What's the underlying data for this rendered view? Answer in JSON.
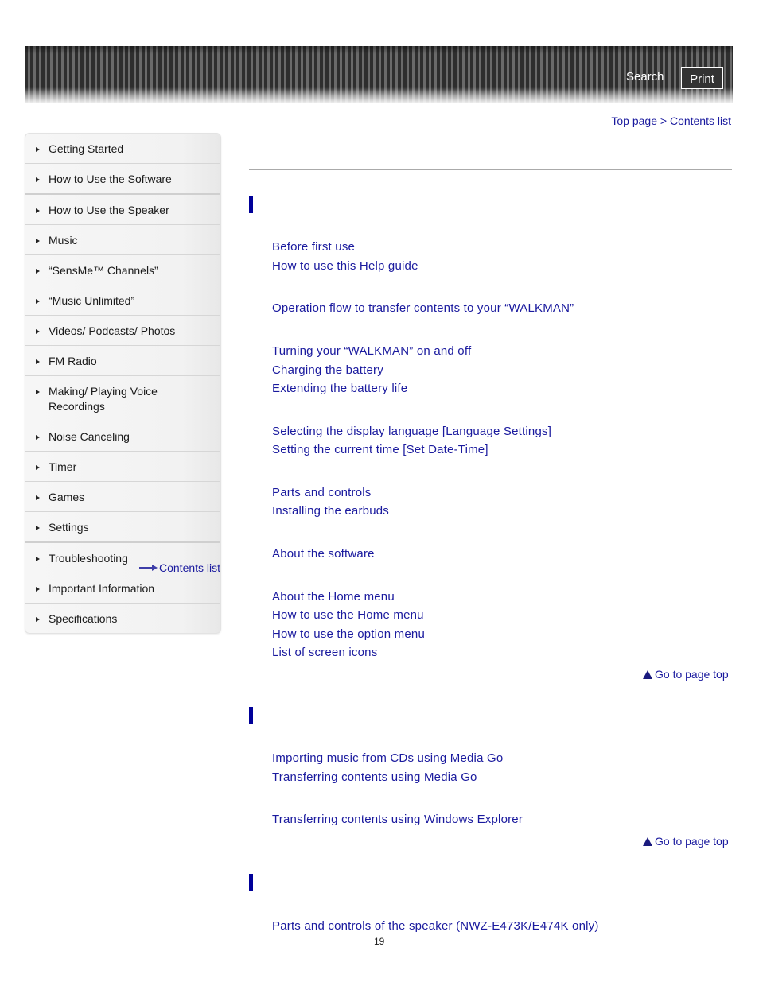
{
  "header": {
    "search_label": "Search",
    "print_label": "Print"
  },
  "breadcrumb": {
    "top_page": "Top page",
    "separator": ">",
    "contents_list": "Contents list"
  },
  "sidebar": {
    "items": [
      {
        "label": "Getting Started"
      },
      {
        "label": "How to Use the Software"
      },
      {
        "label": "How to Use the Speaker"
      },
      {
        "label": "Music"
      },
      {
        "label": "“SensMe™ Channels”"
      },
      {
        "label": "“Music Unlimited”"
      },
      {
        "label": "Videos/ Podcasts/ Photos"
      },
      {
        "label": "FM Radio"
      },
      {
        "label": "Making/ Playing Voice Recordings"
      },
      {
        "label": "Noise Canceling"
      },
      {
        "label": "Timer"
      },
      {
        "label": "Games"
      },
      {
        "label": "Settings"
      },
      {
        "label": "Troubleshooting"
      },
      {
        "label": "Important Information"
      },
      {
        "label": "Specifications"
      }
    ],
    "contents_list_label": "Contents list"
  },
  "main": {
    "sections": [
      {
        "links": [
          "Before first use",
          "How to use this Help guide",
          "Operation flow to transfer contents to your “WALKMAN”",
          "Turning your “WALKMAN” on and off",
          "Charging the battery",
          "Extending the battery life",
          "Selecting the display language [Language Settings]",
          "Setting the current time [Set Date-Time]",
          "Parts and controls",
          "Installing the earbuds",
          "About the software",
          "About the Home menu",
          "How to use the Home menu",
          "How to use the option menu",
          "List of screen icons"
        ],
        "go_to_top": "Go to page top"
      },
      {
        "links": [
          "Importing music from CDs using Media Go",
          "Transferring contents using Media Go",
          "Transferring contents using Windows Explorer"
        ],
        "go_to_top": "Go to page top"
      },
      {
        "links": [
          "Parts and controls of the speaker (NWZ-E473K/E474K only)"
        ]
      }
    ]
  },
  "footer": {
    "page_number": "19"
  },
  "colors": {
    "link": "#1a1a9e",
    "section_bar": "#000099"
  }
}
